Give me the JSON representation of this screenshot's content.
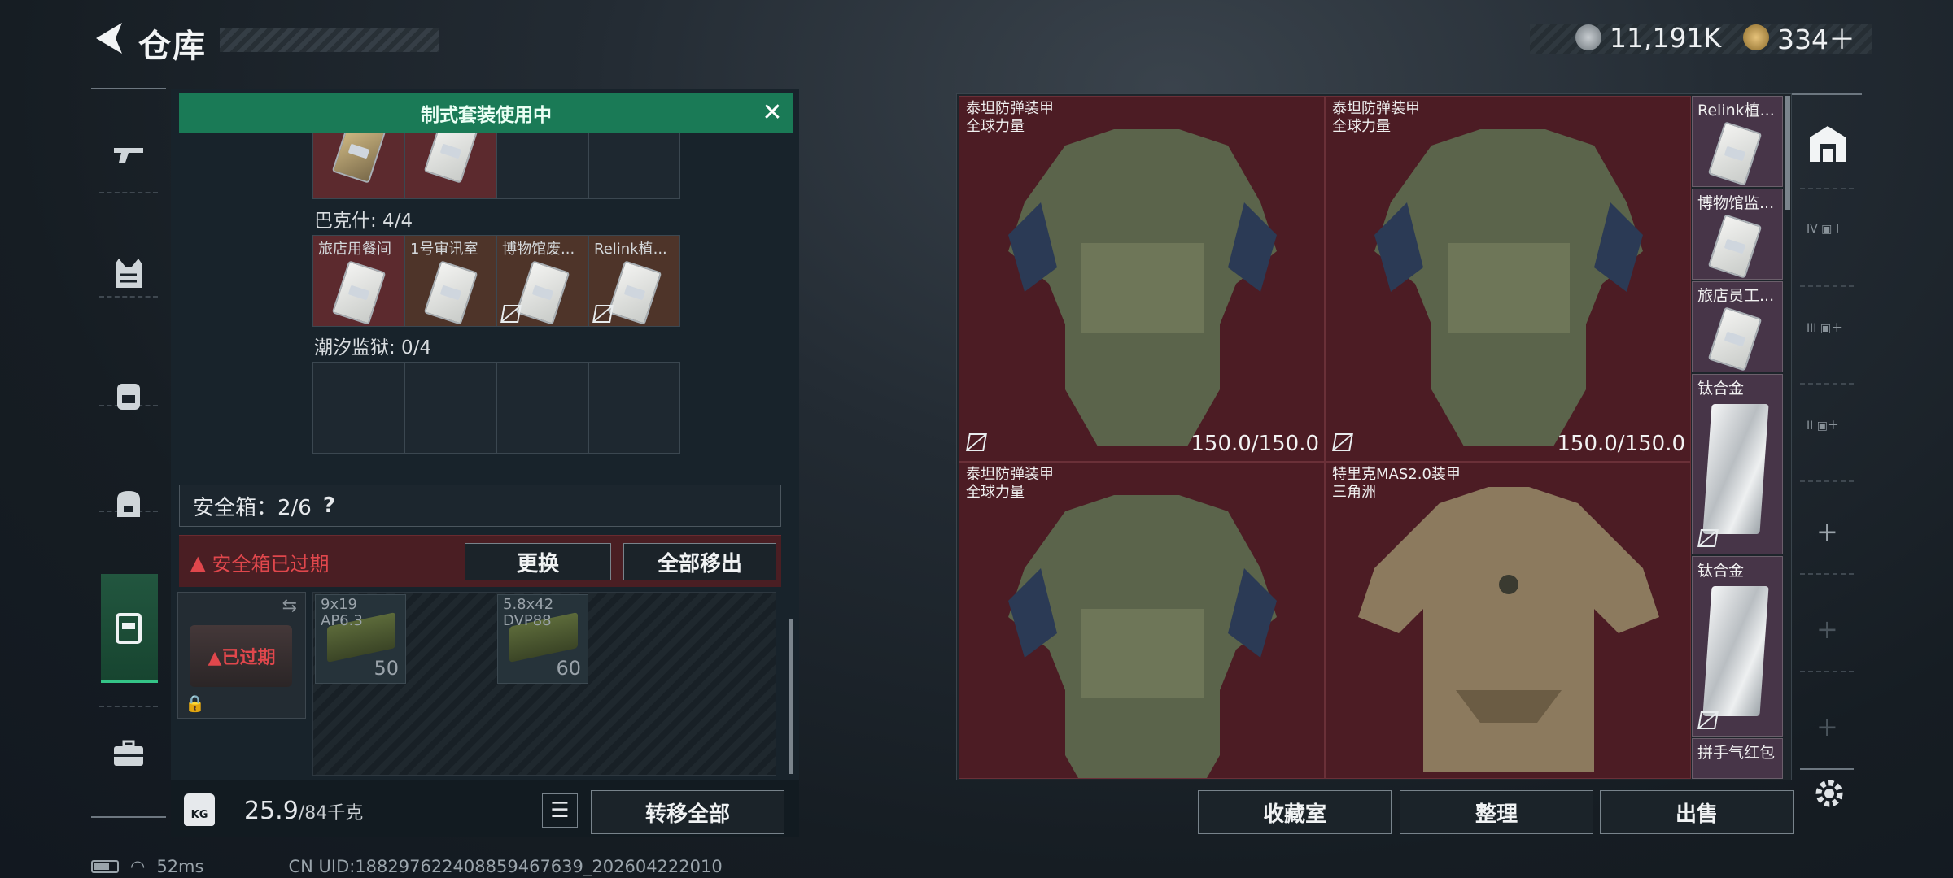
{
  "header": {
    "title": "仓库",
    "currency_a": "11,191K",
    "currency_b": "334＋"
  },
  "banner": {
    "label": "制式套装使用中"
  },
  "left_panel": {
    "top_row": [
      "",
      "",
      "",
      ""
    ],
    "bakeshi": {
      "label": "巴克什: 4/4",
      "items": [
        "旅店用餐间",
        "1号审讯室",
        "博物馆废...",
        "Relink植..."
      ]
    },
    "chaoxi": {
      "label": "潮汐监狱: 0/4"
    },
    "safe_box": {
      "label": "安全箱：2/6",
      "help": "?",
      "warning": "安全箱已过期",
      "replace": "更换",
      "remove_all": "全部移出",
      "expired_tag": "已过期"
    },
    "ammo": [
      {
        "label1": "9x19",
        "label2": "AP6.3",
        "count": "50"
      },
      {
        "label1": "5.8x42",
        "label2": "DVP88",
        "count": "60"
      }
    ],
    "weight": {
      "current": "25.9",
      "max": "/84千克",
      "kg_icon": "KG"
    },
    "transfer_all": "转移全部"
  },
  "right_panel": {
    "armors": [
      {
        "name": "泰坦防弹装甲",
        "tag": "全球力量",
        "durability": "150.0/150.0"
      },
      {
        "name": "泰坦防弹装甲",
        "tag": "全球力量",
        "durability": "150.0/150.0"
      },
      {
        "name": "泰坦防弹装甲",
        "tag": "全球力量",
        "durability": ""
      },
      {
        "name": "特里克MAS2.0装甲",
        "tag": "三角洲",
        "durability": ""
      }
    ],
    "side_items": [
      "Relink植...",
      "博物馆监...",
      "旅店员工...",
      "钛合金",
      "钛合金",
      "拼手气红包"
    ],
    "buttons": {
      "collection": "收藏室",
      "sort": "整理",
      "sell": "出售"
    }
  },
  "right_nav": {
    "tier4": "IV",
    "tier3": "III",
    "tier2": "II",
    "plus": "+"
  },
  "status": {
    "ping": "52ms",
    "uid": "CN UID:1882976224088594676​39_202604222010"
  },
  "colors": {
    "accent_green": "#1a7a56",
    "expired_red": "#e0474c",
    "armor_bg": "#4c1c24"
  }
}
